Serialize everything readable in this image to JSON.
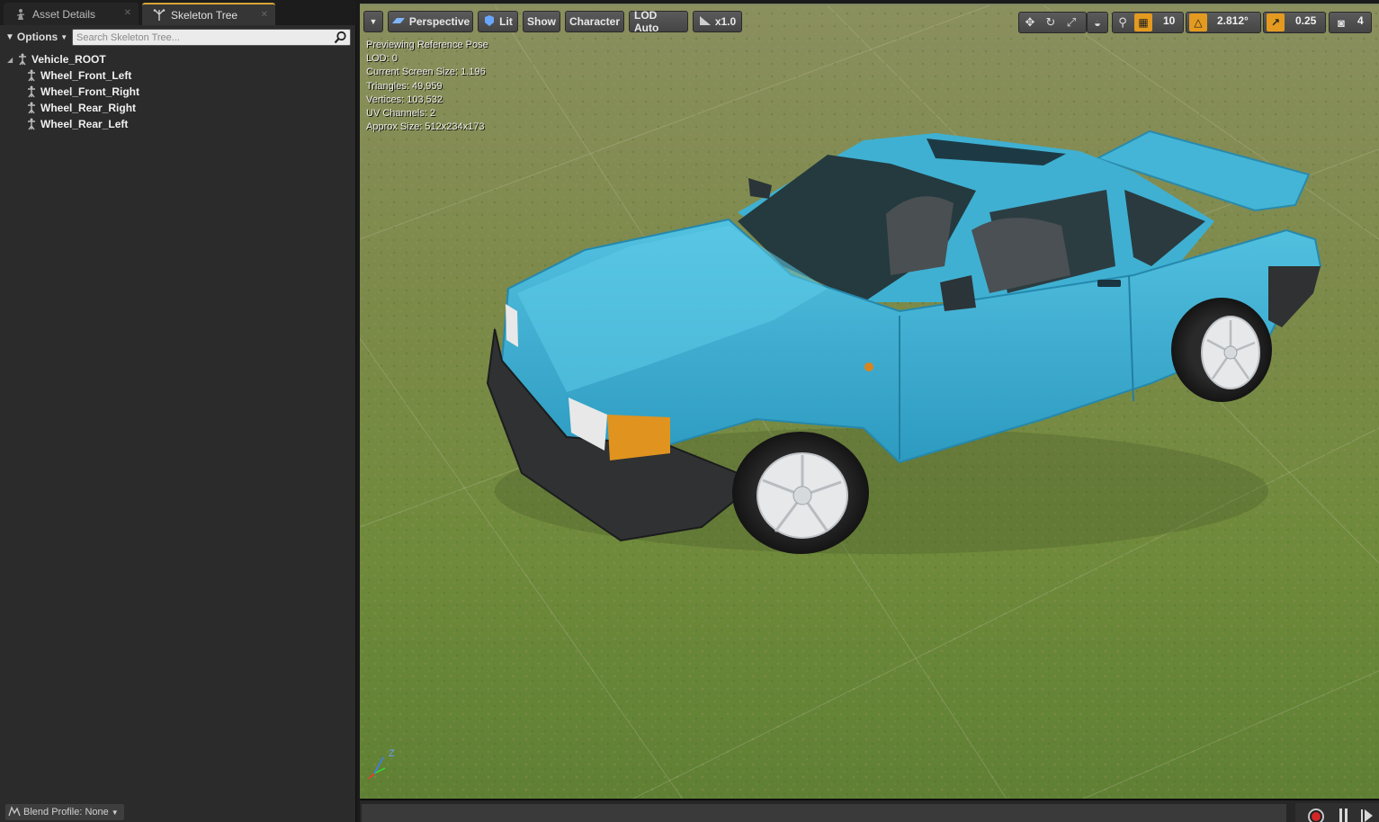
{
  "tabs": [
    {
      "label": "Asset Details",
      "icon": "asset-details-icon",
      "active": false
    },
    {
      "label": "Skeleton Tree",
      "icon": "skeleton-tree-icon",
      "active": true
    }
  ],
  "skeleton_panel": {
    "options_label": "Options",
    "search_placeholder": "Search Skeleton Tree...",
    "root_bone": "Vehicle_ROOT",
    "bones": [
      "Wheel_Front_Left",
      "Wheel_Front_Right",
      "Wheel_Rear_Right",
      "Wheel_Rear_Left"
    ],
    "blend_profile_label": "Blend Profile: None"
  },
  "viewport": {
    "toolbar": {
      "view_mode": "Perspective",
      "lighting": "Lit",
      "show": "Show",
      "character": "Character",
      "lod": "LOD Auto",
      "play_speed": "x1.0"
    },
    "snap": {
      "grid_size": "10",
      "rotation_snap": "2.812°",
      "scale_snap": "0.25",
      "camera_speed": "4"
    },
    "stats": {
      "line1": "Previewing Reference Pose",
      "line2": "LOD: 0",
      "line3": "Current Screen Size: 1.196",
      "line4": "Triangles: 49,959",
      "line5": "Vertices: 103,532",
      "line6": "UV Channels: 2",
      "line7": "Approx Size: 512x234x173"
    },
    "gizmo_axis_label": "Z"
  },
  "colors": {
    "accent_orange": "#e39a1f",
    "tab_highlight": "#d7a636",
    "car_body": "#3aa9c9",
    "grass": "#6d7c3f",
    "record_red": "#d32727"
  }
}
